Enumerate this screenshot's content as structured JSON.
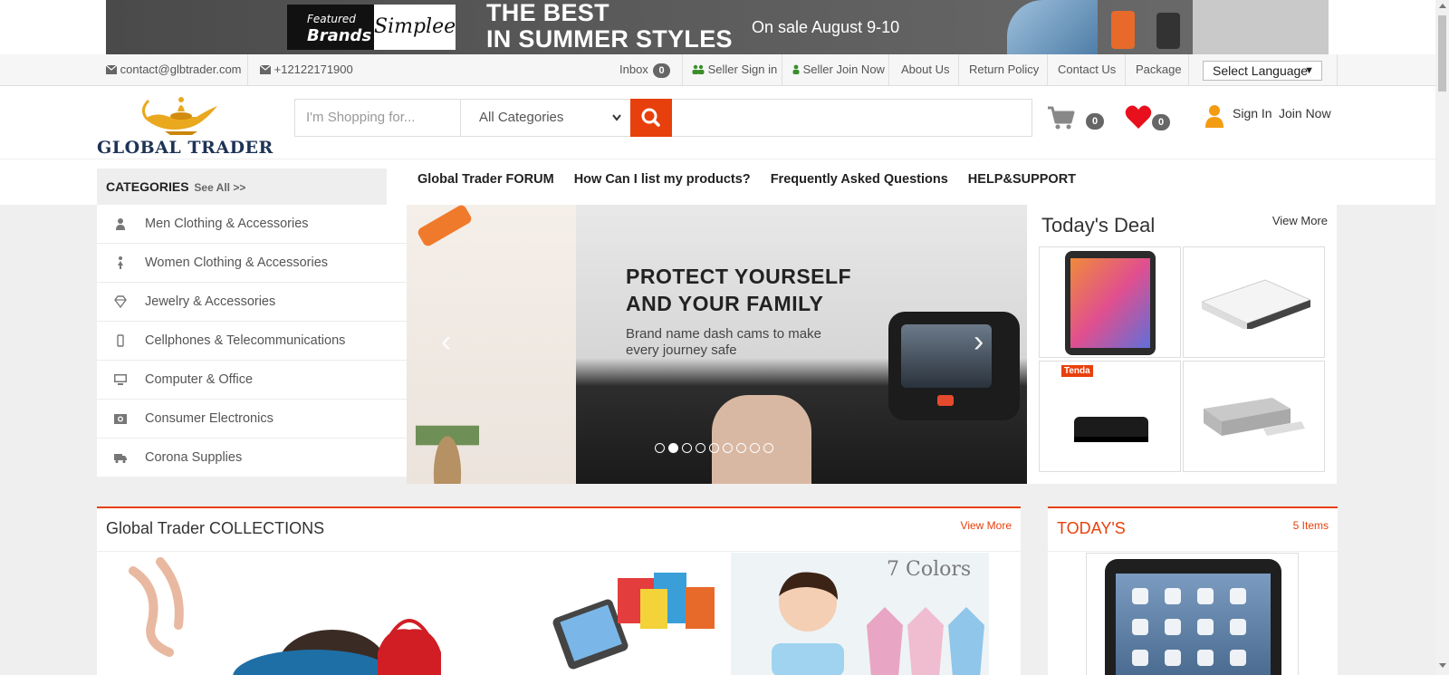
{
  "banner": {
    "featured_top": "Featured",
    "featured_bottom": "Brands",
    "brand": "Simplee",
    "headline_1": "THE BEST",
    "headline_2": "IN SUMMER STYLES",
    "sale": "On sale August 9-10"
  },
  "contact": {
    "email": "contact@glbtrader.com",
    "phone": "+12122171900"
  },
  "topnav": {
    "inbox_label": "Inbox",
    "inbox_count": "0",
    "seller_signin": "Seller Sign in",
    "seller_join": "Seller Join Now",
    "about": "About Us",
    "return_policy": "Return Policy",
    "contact_us": "Contact Us",
    "package": "Package",
    "language": "Select Language"
  },
  "header": {
    "logo_text": "GLOBAL TRADER",
    "search_placeholder": "I'm Shopping for...",
    "category_selected": "All Categories",
    "cart_count": "0",
    "wishlist_count": "0",
    "sign_in": "Sign In",
    "join_now": "Join Now"
  },
  "categories": {
    "title": "CATEGORIES",
    "see_all": "See All >>",
    "items": [
      {
        "label": "Men Clothing & Accessories",
        "icon": "person-icon"
      },
      {
        "label": "Women Clothing & Accessories",
        "icon": "woman-icon"
      },
      {
        "label": "Jewelry & Accessories",
        "icon": "diamond-icon"
      },
      {
        "label": "Cellphones & Telecommunications",
        "icon": "mobile-icon"
      },
      {
        "label": "Computer & Office",
        "icon": "desktop-icon"
      },
      {
        "label": "Consumer Electronics",
        "icon": "camera-icon"
      },
      {
        "label": "Corona Supplies",
        "icon": "truck-icon"
      }
    ]
  },
  "mainnav": {
    "forum": "Global Trader FORUM",
    "list_products": "How Can I list my products?",
    "faq": "Frequently Asked Questions",
    "support": "HELP&SUPPORT"
  },
  "slider": {
    "headline_1": "PROTECT YOURSELF",
    "headline_2": "AND YOUR FAMILY",
    "sub_1": "Brand name dash cams to make",
    "sub_2": "every journey safe",
    "active_slide": 2,
    "slide_count": 9
  },
  "deal": {
    "title": "Today's Deal",
    "view_more": "View More",
    "tenda_label": "Tenda"
  },
  "collections": {
    "title": "Global Trader COLLECTIONS",
    "view_more": "View More",
    "colors_label": "7 Colors"
  },
  "todays": {
    "title": "TODAY'S",
    "count": "5 Items"
  },
  "colors": {
    "accent": "#e8400c",
    "badge": "#666666",
    "logo_navy": "#1e3355",
    "heart": "#e8101c",
    "user": "#f39c12"
  }
}
